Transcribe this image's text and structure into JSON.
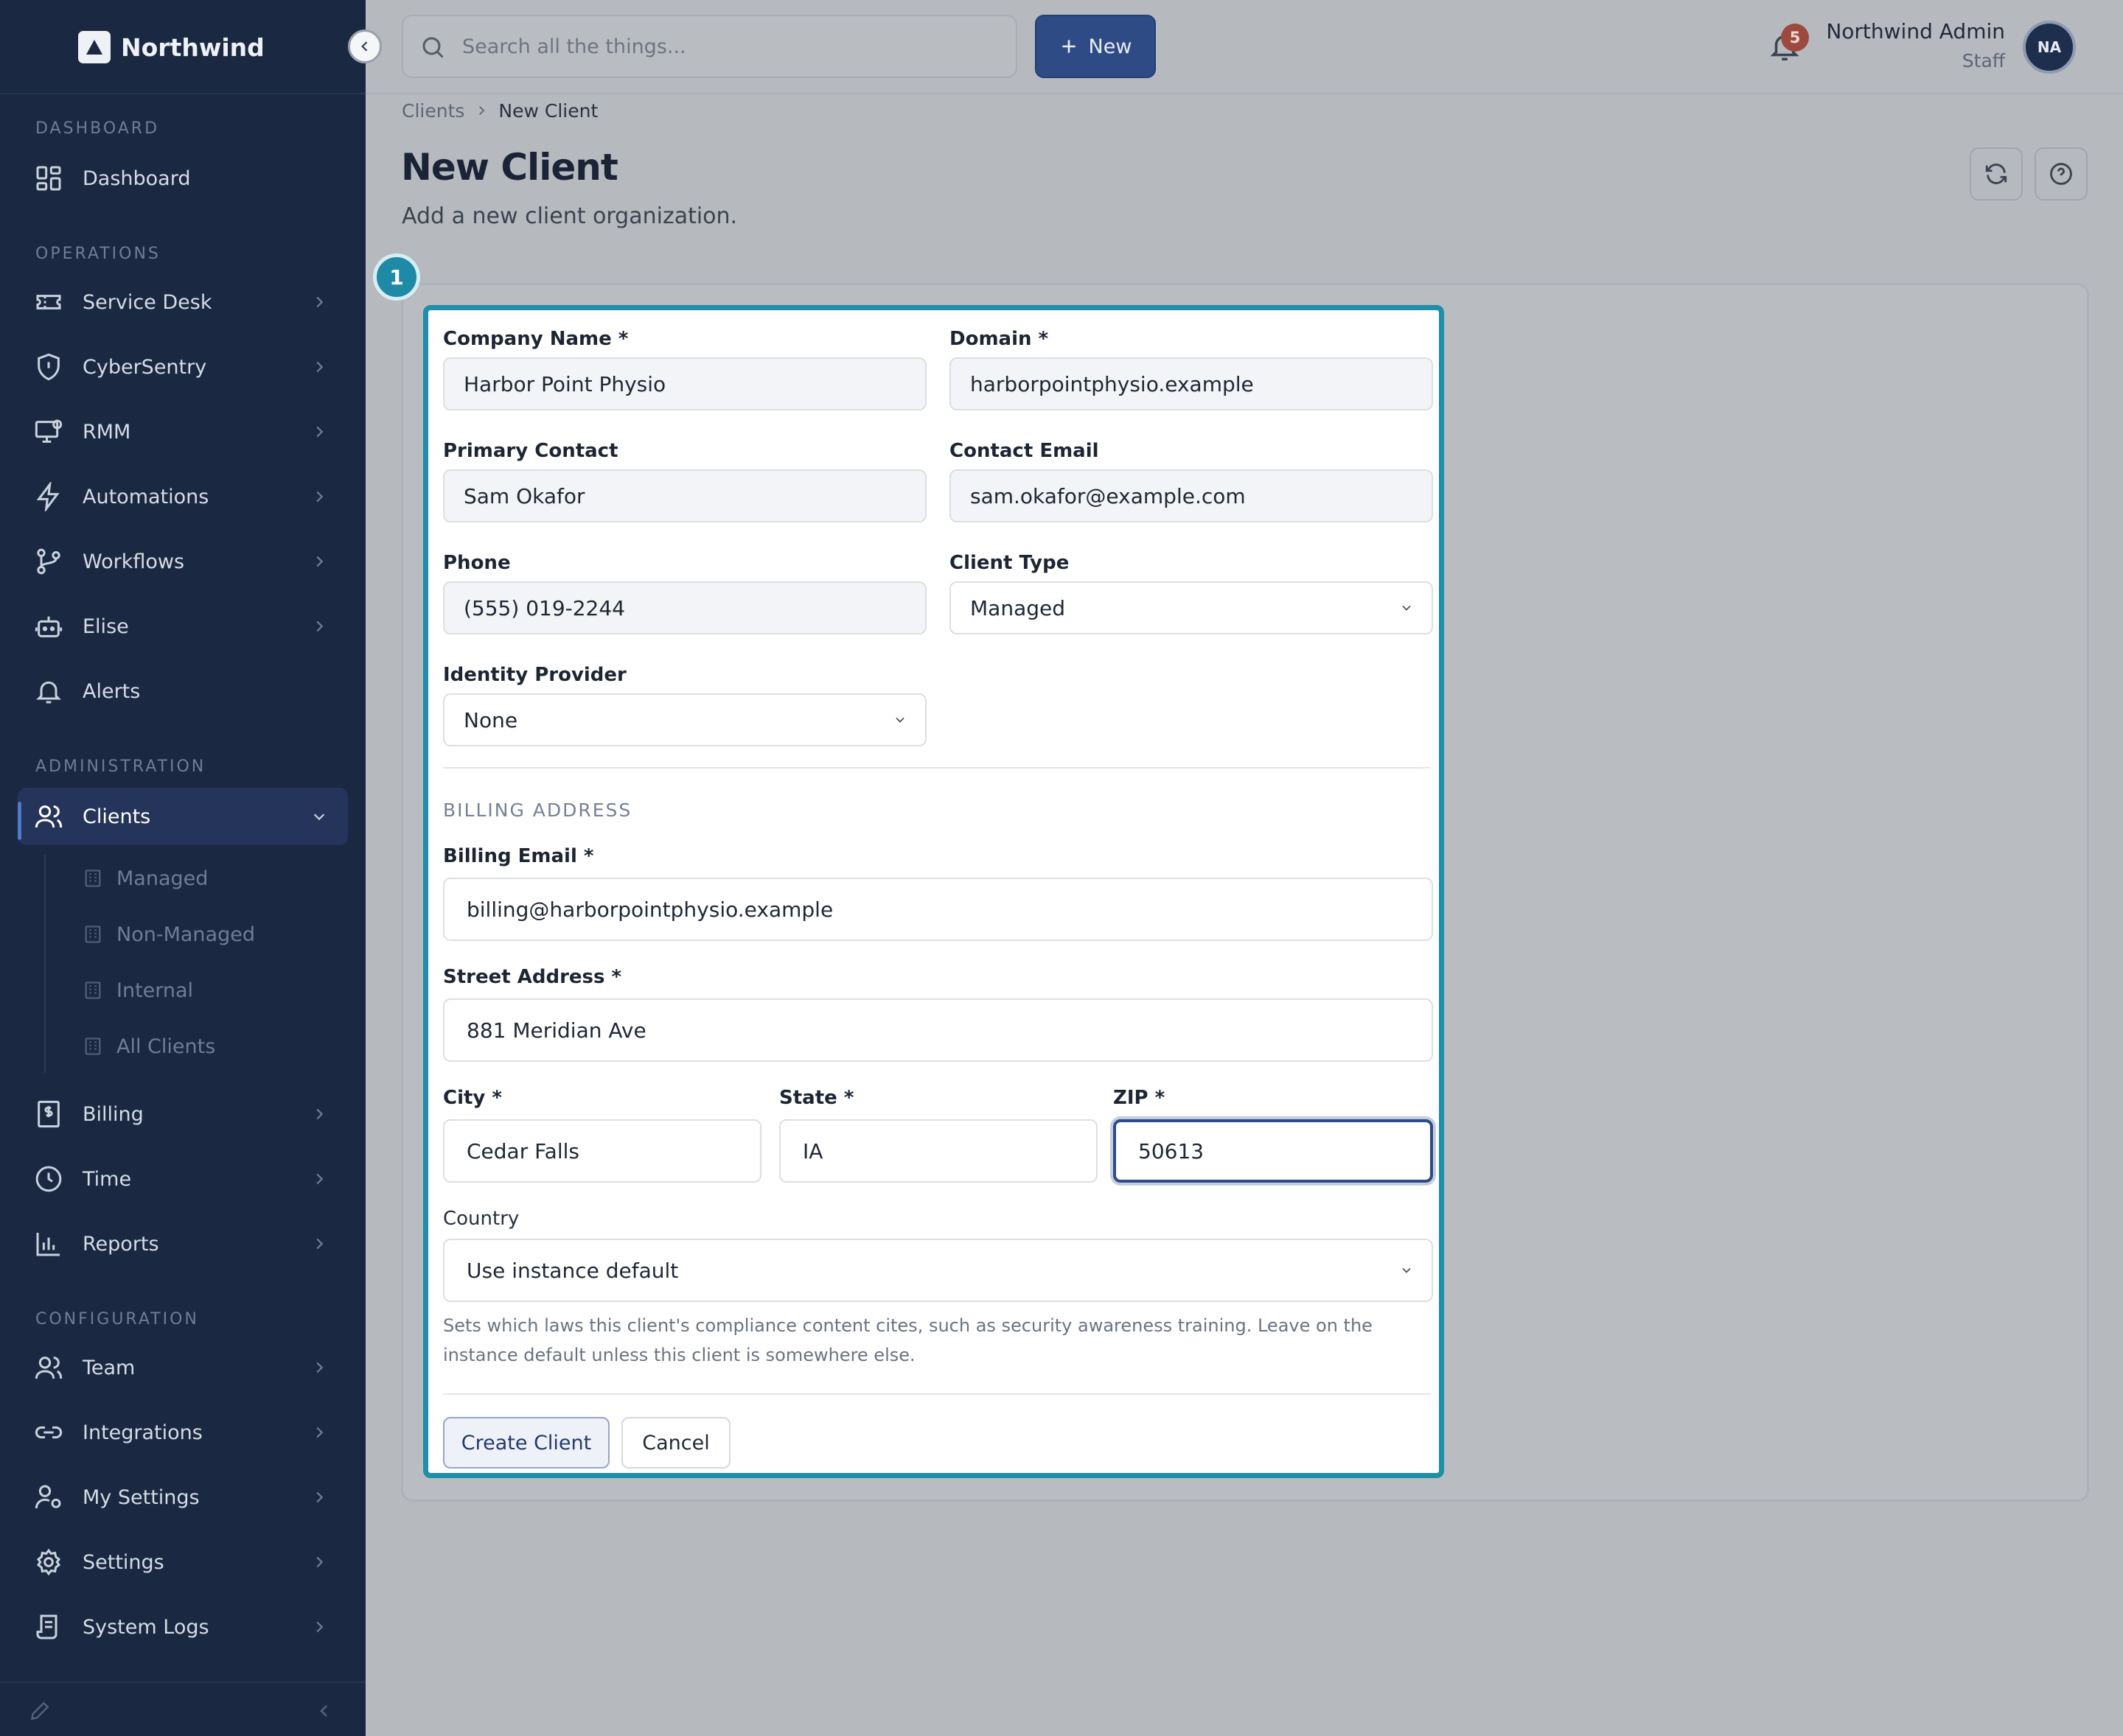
{
  "brand": {
    "name": "Northwind"
  },
  "sidebar": {
    "sections": {
      "dashboard": "DASHBOARD",
      "operations": "OPERATIONS",
      "administration": "ADMINISTRATION",
      "configuration": "CONFIGURATION"
    },
    "items": {
      "dashboard": "Dashboard",
      "service_desk": "Service Desk",
      "cybersentry": "CyberSentry",
      "rmm": "RMM",
      "automations": "Automations",
      "workflows": "Workflows",
      "elise": "Elise",
      "alerts": "Alerts",
      "clients": "Clients",
      "billing": "Billing",
      "time": "Time",
      "reports": "Reports",
      "team": "Team",
      "integrations": "Integrations",
      "my_settings": "My Settings",
      "settings": "Settings",
      "system_logs": "System Logs"
    },
    "client_sub": {
      "managed": "Managed",
      "non_managed": "Non-Managed",
      "internal": "Internal",
      "all": "All Clients"
    }
  },
  "topbar": {
    "search_placeholder": "Search all the things...",
    "new_label": "New",
    "notification_count": "5",
    "user_name": "Northwind Admin",
    "user_role": "Staff",
    "user_initials": "NA"
  },
  "breadcrumb": {
    "parent": "Clients",
    "current": "New Client"
  },
  "page": {
    "title": "New Client",
    "subtitle": "Add a new client organization."
  },
  "step_number": "1",
  "form": {
    "company_name": {
      "label": "Company Name *",
      "value": "Harbor Point Physio"
    },
    "domain": {
      "label": "Domain *",
      "value": "harborpointphysio.example"
    },
    "primary_contact": {
      "label": "Primary Contact",
      "value": "Sam Okafor"
    },
    "contact_email": {
      "label": "Contact Email",
      "value": "sam.okafor@example.com"
    },
    "phone": {
      "label": "Phone",
      "value": "(555) 019-2244"
    },
    "client_type": {
      "label": "Client Type",
      "value": "Managed"
    },
    "identity_provider": {
      "label": "Identity Provider",
      "value": "None"
    },
    "billing_section_title": "BILLING ADDRESS",
    "billing_email": {
      "label": "Billing Email *",
      "value": "billing@harborpointphysio.example"
    },
    "street": {
      "label": "Street Address *",
      "value": "881 Meridian Ave"
    },
    "city": {
      "label": "City *",
      "value": "Cedar Falls"
    },
    "state": {
      "label": "State *",
      "value": "IA"
    },
    "zip": {
      "label": "ZIP *",
      "value": "50613"
    },
    "country": {
      "label": "Country",
      "value": "Use instance default",
      "help": "Sets which laws this client's compliance content cites, such as security awareness training. Leave on the instance default unless this client is somewhere else."
    },
    "submit_label": "Create Client",
    "cancel_label": "Cancel"
  },
  "colors": {
    "sidebar_bg": "#1a2842",
    "accent": "#2f4b86",
    "highlight": "#1f8ea9",
    "badge": "#9c4a3e"
  }
}
